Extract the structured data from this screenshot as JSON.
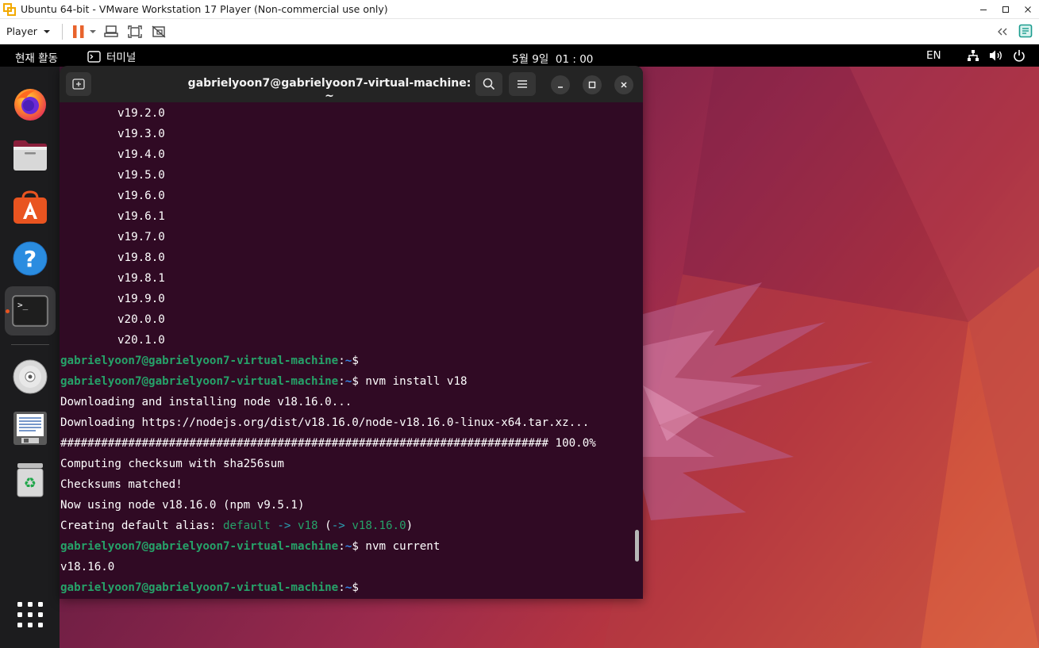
{
  "vm": {
    "title": "Ubuntu 64-bit - VMware Workstation 17 Player (Non-commercial use only)",
    "player_menu": "Player",
    "toolbar_icons": [
      "pause-icon",
      "dropdown-arrow-icon",
      "send-ctrl-alt-del-icon",
      "fullscreen-icon",
      "unity-icon"
    ],
    "right_icons": [
      "collapse-double-chevron-icon",
      "message-log-icon"
    ],
    "window_controls": [
      "minimize-icon",
      "maximize-icon",
      "close-icon"
    ]
  },
  "topbar": {
    "activities": "현재 활동",
    "app_menu": "터미널",
    "clock": "5월 9일  01 : 00",
    "input_lang": "EN",
    "system_icons": [
      "network-icon",
      "volume-icon",
      "power-icon"
    ]
  },
  "dock": {
    "items": [
      {
        "name": "firefox",
        "icon": "firefox-icon"
      },
      {
        "name": "files",
        "icon": "files-icon"
      },
      {
        "name": "app-center",
        "icon": "app-center-icon"
      },
      {
        "name": "help",
        "icon": "help-icon"
      },
      {
        "name": "terminal",
        "icon": "terminal-icon",
        "active": true
      },
      {
        "name": "dvd",
        "icon": "dvd-icon"
      },
      {
        "name": "text-editor",
        "icon": "text-editor-icon"
      },
      {
        "name": "trash",
        "icon": "trash-icon"
      },
      {
        "name": "show-apps",
        "icon": "app-grid-icon"
      }
    ]
  },
  "terminal": {
    "title": "gabrielyoon7@gabrielyoon7-virtual-machine: ~",
    "prompt_user": "gabrielyoon7@gabrielyoon7-virtual-machine",
    "prompt_path": "~",
    "prompt_symbol": "$",
    "version_list": [
      "v19.2.0",
      "v19.3.0",
      "v19.4.0",
      "v19.5.0",
      "v19.6.0",
      "v19.6.1",
      "v19.7.0",
      "v19.8.0",
      "v19.8.1",
      "v19.9.0",
      "v20.0.0",
      "v20.1.0"
    ],
    "cmd_install": "nvm install v18",
    "out_downloading": "Downloading and installing node v18.16.0...",
    "out_url": "Downloading https://nodejs.org/dist/v18.16.0/node-v18.16.0-linux-x64.tar.xz...",
    "out_progress_bar": "######################################################################## 100.0%",
    "out_checksum": "Computing checksum with sha256sum",
    "out_matched": "Checksums matched!",
    "out_now_using": "Now using node v18.16.0 (npm v9.5.1)",
    "alias": {
      "prefix": "Creating default alias: ",
      "name": "default",
      "arrow1": " -> ",
      "target": "v18",
      "open": " (",
      "arrow2": "-> ",
      "resolved": "v18.16.0",
      "close": ")"
    },
    "cmd_current": "nvm current",
    "out_current": "v18.16.0"
  }
}
